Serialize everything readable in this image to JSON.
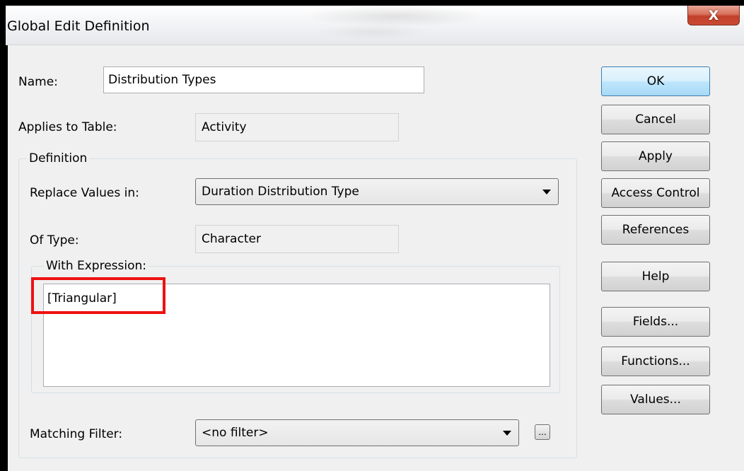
{
  "dialog": {
    "title": "Global Edit Definition",
    "close_glyph": "X"
  },
  "name": {
    "label": "Name:",
    "value": "Distribution Types"
  },
  "applies_to": {
    "label": "Applies to Table:",
    "value": "Activity"
  },
  "definition": {
    "caption": "Definition",
    "replace_label": "Replace Values in:",
    "replace_value": "Duration Distribution Type",
    "type_label": "Of Type:",
    "type_value": "Character",
    "expression_caption": "With Expression:",
    "expression_value": "[Triangular]"
  },
  "filter": {
    "label": "Matching Filter:",
    "value": "<no filter>",
    "more_label": "..."
  },
  "buttons": {
    "ok": "OK",
    "cancel": "Cancel",
    "apply": "Apply",
    "access_control": "Access Control",
    "references": "References",
    "help": "Help",
    "fields": "Fields...",
    "functions": "Functions...",
    "values": "Values..."
  },
  "colors": {
    "highlight": "#ee1111",
    "default_button": "#bee6fd",
    "close_button": "#c94a34"
  }
}
